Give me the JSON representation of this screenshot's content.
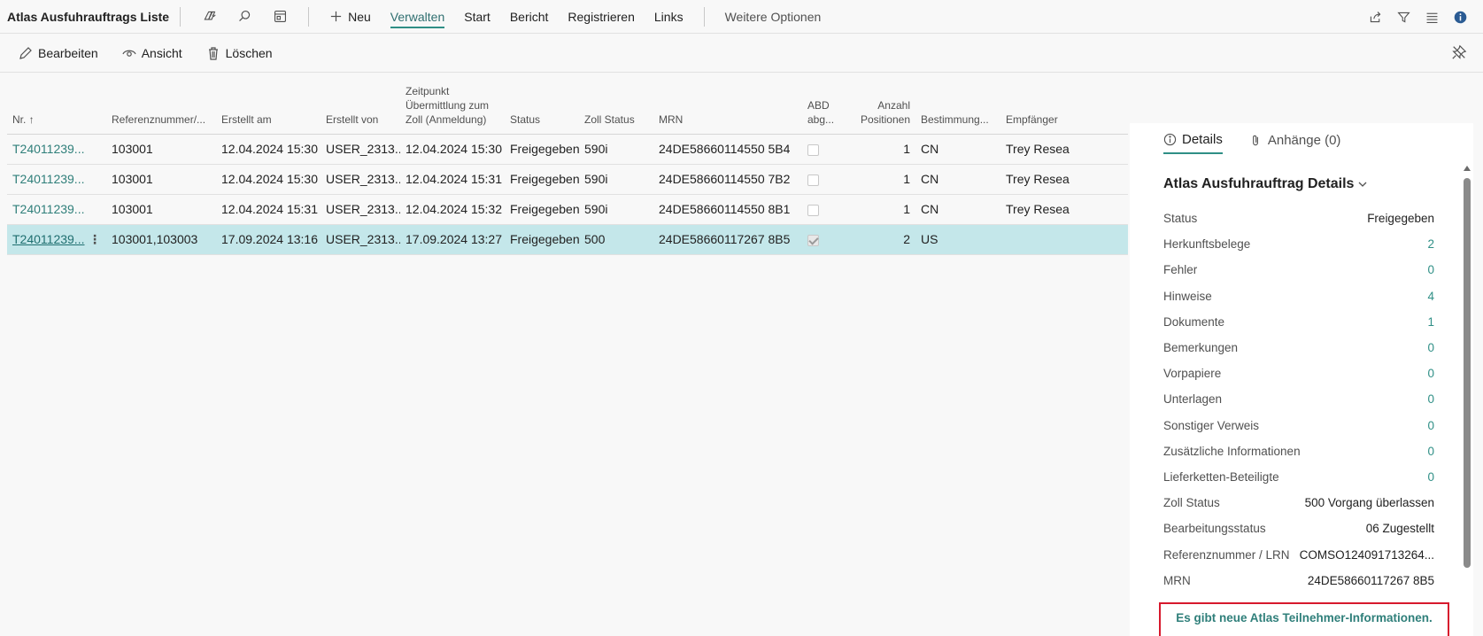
{
  "header": {
    "title": "Atlas Ausfuhrauftrags Liste",
    "menu": [
      {
        "label": "Neu"
      },
      {
        "label": "Verwalten",
        "active": true
      },
      {
        "label": "Start"
      },
      {
        "label": "Bericht"
      },
      {
        "label": "Registrieren"
      },
      {
        "label": "Links"
      }
    ],
    "more_options": "Weitere Optionen"
  },
  "actions": {
    "edit": "Bearbeiten",
    "view": "Ansicht",
    "delete": "Löschen"
  },
  "table": {
    "columns": {
      "nr": "Nr. ↑",
      "ref": "Referenznummer/...",
      "created_at": "Erstellt am",
      "created_by": "Erstellt von",
      "transmit": "Zeitpunkt Übermittlung zum Zoll (Anmeldung)",
      "status": "Status",
      "customs_status": "Zoll Status",
      "mrn": "MRN",
      "abd": "ABD abg...",
      "positions": "Anzahl Positionen",
      "destination": "Bestimmung...",
      "recipient": "Empfänger"
    },
    "rows": [
      {
        "nr": "T24011239...",
        "ref": "103001",
        "created_at": "12.04.2024 15:30",
        "created_by": "USER_2313...",
        "transmit": "12.04.2024 15:30",
        "status": "Freigegeben",
        "customs_status": "590i",
        "mrn": "24DE58660114550 5B4",
        "abd": false,
        "positions": "1",
        "destination": "CN",
        "recipient": "Trey Resea"
      },
      {
        "nr": "T24011239...",
        "ref": "103001",
        "created_at": "12.04.2024 15:30",
        "created_by": "USER_2313...",
        "transmit": "12.04.2024 15:31",
        "status": "Freigegeben",
        "customs_status": "590i",
        "mrn": "24DE58660114550 7B2",
        "abd": false,
        "positions": "1",
        "destination": "CN",
        "recipient": "Trey Resea"
      },
      {
        "nr": "T24011239...",
        "ref": "103001",
        "created_at": "12.04.2024 15:31",
        "created_by": "USER_2313...",
        "transmit": "12.04.2024 15:32",
        "status": "Freigegeben",
        "customs_status": "590i",
        "mrn": "24DE58660114550 8B1",
        "abd": false,
        "positions": "1",
        "destination": "CN",
        "recipient": "Trey Resea"
      },
      {
        "nr": "T24011239...",
        "ref": "103001,103003",
        "created_at": "17.09.2024 13:16",
        "created_by": "USER_2313...",
        "transmit": "17.09.2024 13:27",
        "status": "Freigegeben",
        "customs_status": "500",
        "mrn": "24DE58660117267 8B5",
        "abd": true,
        "positions": "2",
        "destination": "US",
        "recipient": "",
        "selected": true
      }
    ]
  },
  "factbox": {
    "tab_details": "Details",
    "tab_attachments": "Anhänge (0)",
    "heading": "Atlas Ausfuhrauftrag Details",
    "rows": [
      {
        "label": "Status",
        "value": "Freigegeben",
        "link": false
      },
      {
        "label": "Herkunftsbelege",
        "value": "2",
        "link": true
      },
      {
        "label": "Fehler",
        "value": "0",
        "link": true
      },
      {
        "label": "Hinweise",
        "value": "4",
        "link": true
      },
      {
        "label": "Dokumente",
        "value": "1",
        "link": true
      },
      {
        "label": "Bemerkungen",
        "value": "0",
        "link": true
      },
      {
        "label": "Vorpapiere",
        "value": "0",
        "link": true
      },
      {
        "label": "Unterlagen",
        "value": "0",
        "link": true
      },
      {
        "label": "Sonstiger Verweis",
        "value": "0",
        "link": true
      },
      {
        "label": "Zusätzliche Informationen",
        "value": "0",
        "link": true
      },
      {
        "label": "Lieferketten-Beteiligte",
        "value": "0",
        "link": true
      },
      {
        "label": "Zoll Status",
        "value": "500 Vorgang überlassen",
        "link": false
      },
      {
        "label": "Bearbeitungsstatus",
        "value": "06 Zugestellt",
        "link": false
      },
      {
        "label": "Referenznummer / LRN",
        "value": "COMSO124091713264...",
        "link": false
      },
      {
        "label": "MRN",
        "value": "24DE58660117267 8B5",
        "link": false
      }
    ],
    "notice": "Es gibt neue Atlas Teilnehmer-Informationen."
  }
}
